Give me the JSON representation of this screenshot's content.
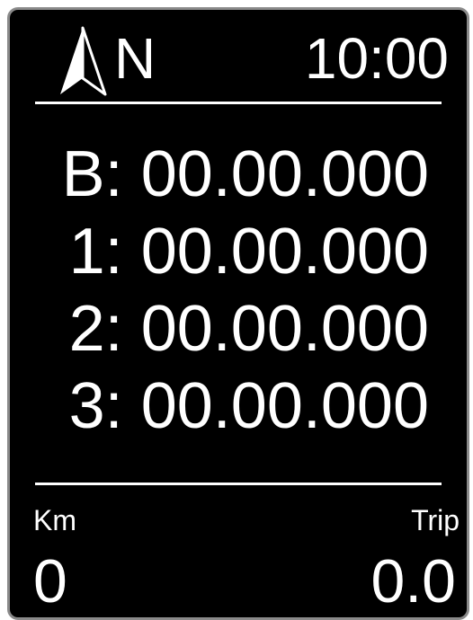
{
  "header": {
    "compass_icon": "north-arrow-icon",
    "heading": "N",
    "time": "10:00"
  },
  "waypoints": [
    {
      "label": "B:",
      "value": "00.00.000"
    },
    {
      "label": "1:",
      "value": "00.00.000"
    },
    {
      "label": "2:",
      "value": "00.00.000"
    },
    {
      "label": "3:",
      "value": "00.00.000"
    }
  ],
  "footer": {
    "km_label": "Km",
    "km_value": "0",
    "trip_label": "Trip",
    "trip_value": "0.0"
  },
  "colors": {
    "background": "#000000",
    "foreground": "#ffffff",
    "bezel": "#8a8a8a"
  }
}
